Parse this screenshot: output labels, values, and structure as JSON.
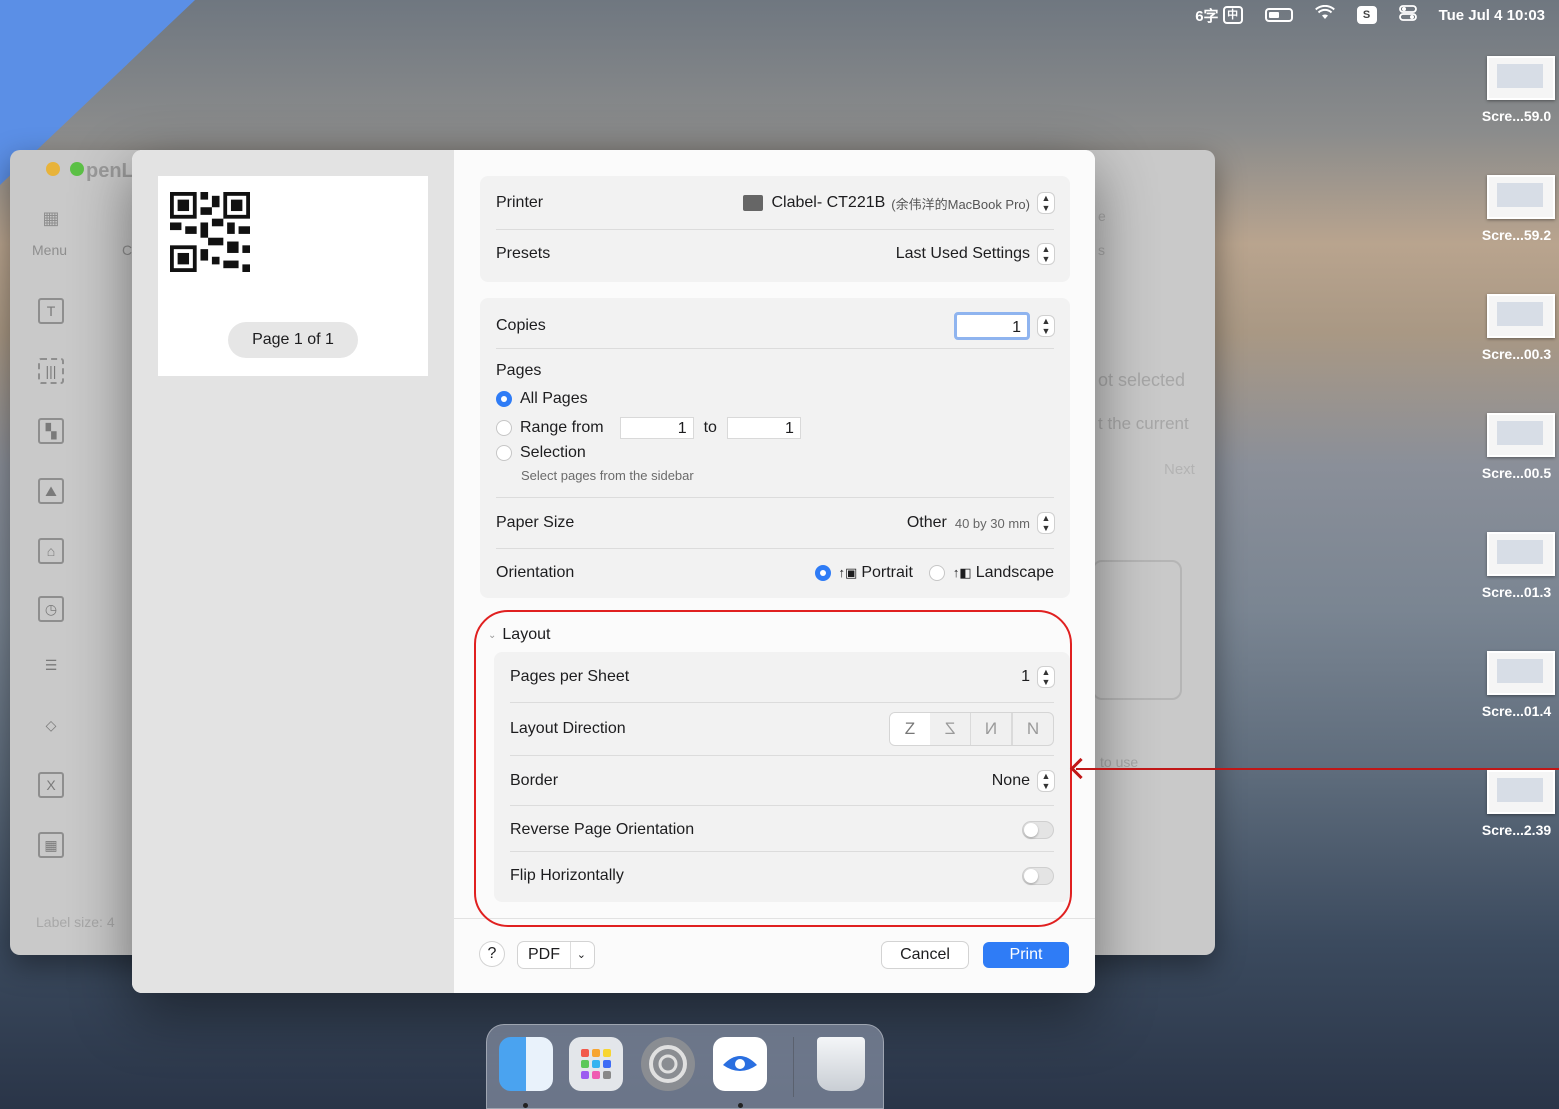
{
  "menubar": {
    "input_method": "6字",
    "ime_label": "中",
    "sogou_label": "S",
    "datetime": "Tue Jul 4  10:03"
  },
  "desktop_files": [
    {
      "label": "Scre...59.0"
    },
    {
      "label": "Scre...59.2"
    },
    {
      "label": "Scre...00.3"
    },
    {
      "label": "Scre...00.5"
    },
    {
      "label": "Scre...01.3"
    },
    {
      "label": "Scre...01.4"
    },
    {
      "label": "Scre...2.39"
    }
  ],
  "background_app": {
    "title_fragment": "penL",
    "menu_label": "Menu",
    "not_selected": "ot selected",
    "current_hint": "t the current",
    "next": "Next",
    "to_use": "to use",
    "side_letter_e": "e",
    "side_letter_s": "s",
    "side_letter_c": "C",
    "label_size": "Label size:  4"
  },
  "print_dialog": {
    "page_badge": "Page 1 of 1",
    "printer_label": "Printer",
    "printer_value": "Clabel- CT221B",
    "printer_host": "(余伟洋的MacBook Pro)",
    "presets_label": "Presets",
    "presets_value": "Last Used Settings",
    "copies_label": "Copies",
    "copies_value": "1",
    "pages_label": "Pages",
    "all_pages": "All Pages",
    "range_from": "Range from",
    "range_from_value": "1",
    "range_to": "to",
    "range_to_value": "1",
    "selection": "Selection",
    "selection_hint": "Select pages from the sidebar",
    "paper_size_label": "Paper Size",
    "paper_size_value": "Other",
    "paper_size_dims": "40 by 30 mm",
    "orientation_label": "Orientation",
    "portrait": "Portrait",
    "landscape": "Landscape",
    "layout_section": "Layout",
    "pages_per_sheet_label": "Pages per Sheet",
    "pages_per_sheet_value": "1",
    "layout_direction_label": "Layout Direction",
    "layout_direction_glyphs": [
      "Z",
      "Z",
      "N",
      "N"
    ],
    "border_label": "Border",
    "border_value": "None",
    "reverse_label": "Reverse Page Orientation",
    "flip_label": "Flip Horizontally",
    "help_label": "?",
    "pdf_label": "PDF",
    "cancel_label": "Cancel",
    "print_label": "Print"
  },
  "colors": {
    "accent": "#2f7cf6",
    "annotation": "#e02020"
  }
}
